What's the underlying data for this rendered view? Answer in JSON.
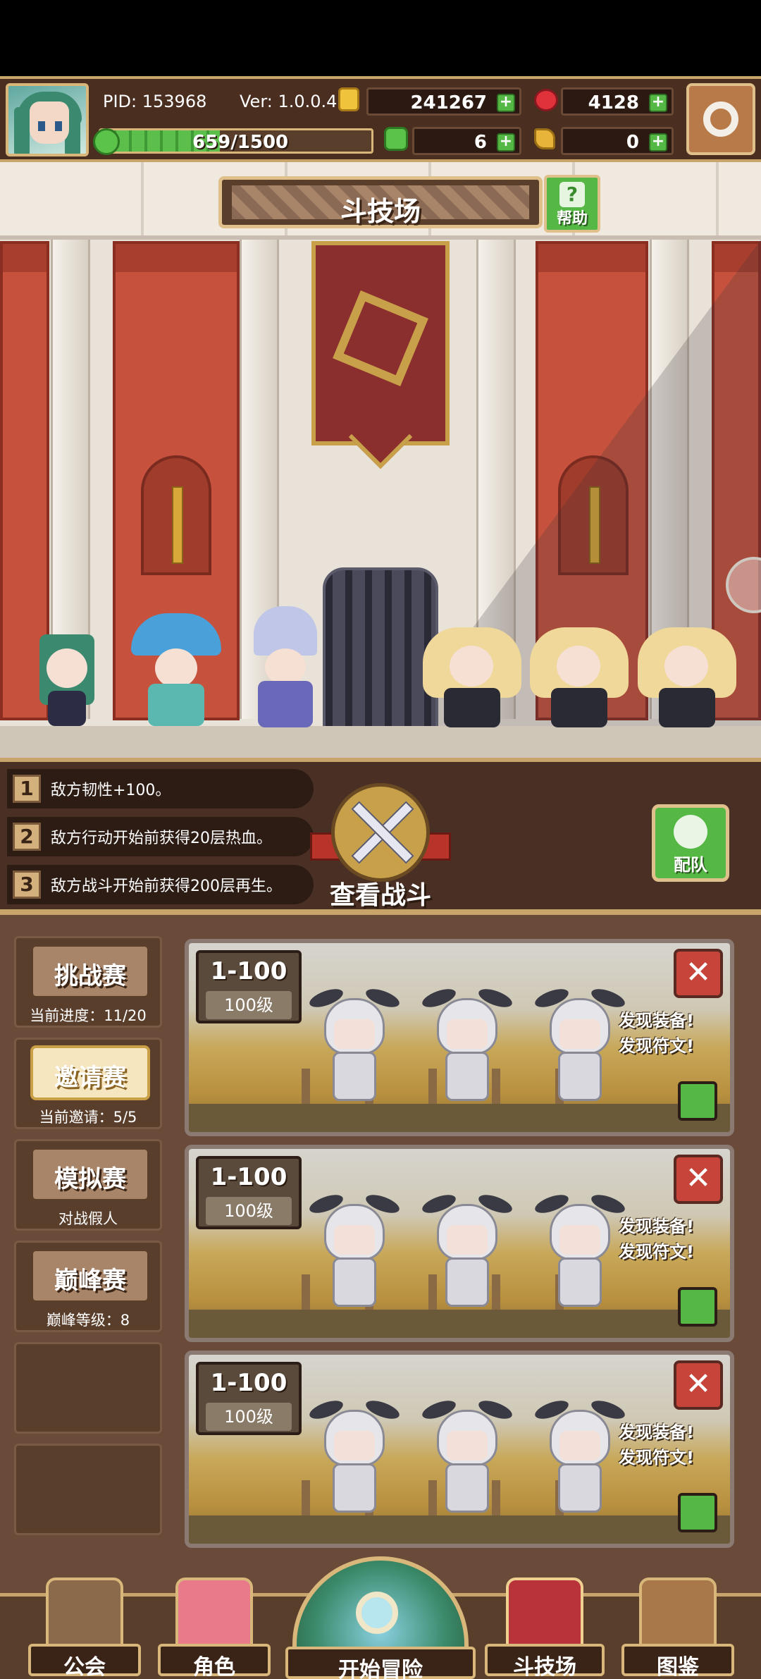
{
  "hud": {
    "pid": "PID: 153968",
    "version": "Ver: 1.0.0.4",
    "gold": "241267",
    "gems": "4128",
    "stamina": "659/1500",
    "stamina_fraction": 0.44,
    "clover": "6",
    "keys": "0",
    "plus": "+"
  },
  "arena": {
    "title": "斗技场",
    "help_label": "帮助"
  },
  "buffs": [
    {
      "num": "1",
      "text": "敌方韧性+100。"
    },
    {
      "num": "2",
      "text": "敌方行动开始前获得20层热血。"
    },
    {
      "num": "3",
      "text": "敌方战斗开始前获得200层再生。"
    }
  ],
  "view_battle": "查看战斗",
  "team_label": "配队",
  "modes": [
    {
      "label": "挑战赛",
      "sub": "当前进度：11/20"
    },
    {
      "label": "邀请赛",
      "sub": "当前邀请：5/5"
    },
    {
      "label": "模拟赛",
      "sub": "对战假人"
    },
    {
      "label": "巅峰赛",
      "sub": "巅峰等级：8"
    }
  ],
  "cards": [
    {
      "range": "1-100",
      "level": "100级",
      "found1": "发现装备!",
      "found2": "发现符文!",
      "close": "✕"
    },
    {
      "range": "1-100",
      "level": "100级",
      "found1": "发现装备!",
      "found2": "发现符文!",
      "close": "✕"
    },
    {
      "range": "1-100",
      "level": "100级",
      "found1": "发现装备!",
      "found2": "发现符文!",
      "close": "✕"
    }
  ],
  "nav": {
    "guild": "公会",
    "character": "角色",
    "adventure": "开始冒险",
    "arena": "斗技场",
    "codex": "图鉴"
  },
  "colors": {
    "accent_gold": "#c9a46a",
    "panel_brown": "#6a4a38",
    "green_button": "#55b845",
    "red_close": "#c6443a"
  }
}
